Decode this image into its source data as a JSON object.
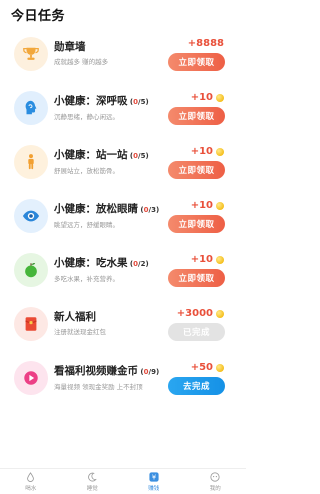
{
  "page": {
    "title": "今日任务"
  },
  "tasks": [
    {
      "title": "勋章墙",
      "progress_cur": "",
      "progress_total": "",
      "desc": "成就越多 赚的越多",
      "reward": "+8888",
      "button": "立即领取",
      "icon": "trophy-icon",
      "icon_bg": "#fdf0de",
      "icon_color": "#f2a73b"
    },
    {
      "title": "小健康：深呼吸",
      "progress_cur": "0",
      "progress_total": "/5",
      "desc": "沉静思绪，静心闲远。",
      "reward": "+10",
      "button": "立即领取",
      "icon": "breath-head-icon",
      "icon_bg": "#e1effd",
      "icon_color": "#2a8de0"
    },
    {
      "title": "小健康：站一站",
      "progress_cur": "0",
      "progress_total": "/5",
      "desc": "舒展站立，放松筋骨。",
      "reward": "+10",
      "button": "立即领取",
      "icon": "standing-person-icon",
      "icon_bg": "#fef1dd",
      "icon_color": "#f2a031"
    },
    {
      "title": "小健康：放松眼睛",
      "progress_cur": "0",
      "progress_total": "/3",
      "desc": "眺望远方，舒缓眼睛。",
      "reward": "+10",
      "button": "立即领取",
      "icon": "eye-icon",
      "icon_bg": "#e3f0fd",
      "icon_color": "#2a86d9"
    },
    {
      "title": "小健康：吃水果",
      "progress_cur": "0",
      "progress_total": "/2",
      "desc": "多吃水果，补充营养。",
      "reward": "+10",
      "button": "立即领取",
      "icon": "apple-icon",
      "icon_bg": "#e6f6e2",
      "icon_color": "#46b53a"
    },
    {
      "title": "新人福利",
      "progress_cur": "",
      "progress_total": "",
      "desc": "注册就送现金红包",
      "reward": "+3000",
      "button": "已完成",
      "icon": "red-envelope-icon",
      "icon_bg": "#fde8e4",
      "icon_color": "#ea4a34"
    },
    {
      "title": "看福利视频赚金币",
      "progress_cur": "0",
      "progress_total": "/9",
      "desc": "海量视频 领现金奖励 上不封顶",
      "reward": "+50",
      "button": "去完成",
      "icon": "play-icon",
      "icon_bg": "#fde4ee",
      "icon_color": "#ec3f86"
    }
  ],
  "nav": [
    {
      "label": "喝水",
      "icon": "water-drop-icon"
    },
    {
      "label": "睡觉",
      "icon": "moon-icon"
    },
    {
      "label": "赚钱",
      "icon": "money-icon"
    },
    {
      "label": "我的",
      "icon": "profile-icon"
    }
  ],
  "colors": {
    "accent_red": "#e9503a",
    "nav_active": "#3b8fe0"
  }
}
